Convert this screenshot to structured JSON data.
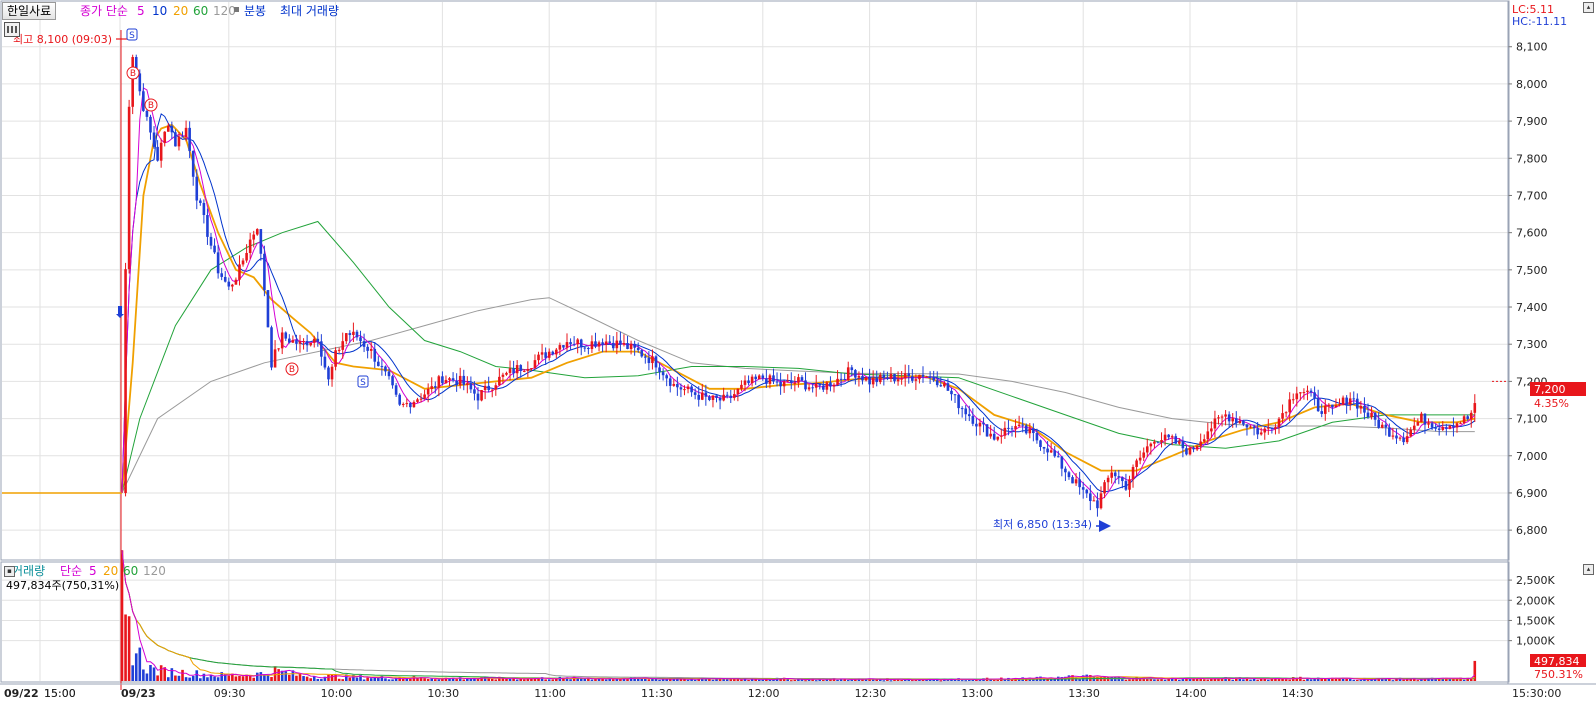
{
  "header": {
    "stock_button": "한일사료",
    "ma_prefix": "종가 단순",
    "ma_periods": [
      "5",
      "10",
      "20",
      "60",
      "120"
    ],
    "toggle_label": "분봉",
    "max_volume_label": "최대 거래량",
    "lc_label": "LC:5.11",
    "hc_label": "HC:-11.11"
  },
  "volume_header": {
    "title": "거래량",
    "ma_prefix": "단순",
    "ma_periods": [
      "5",
      "20",
      "60",
      "120"
    ],
    "current_value": "497,834주(750,31%)"
  },
  "annotations": {
    "high_label": "최고 8,100 (09:03)",
    "low_label": "최저 6,850 (13:34)",
    "signals": [
      "S",
      "B",
      "B",
      "B",
      "S"
    ]
  },
  "price_tag": {
    "value": "7,200",
    "change": "4.35%"
  },
  "volume_tag": {
    "value": "497,834",
    "ratio": "750.31%"
  },
  "colors": {
    "up": "#e8161b",
    "down": "#1f3fd6",
    "ma5": "#d400d4",
    "ma10": "#0033cc",
    "ma20": "#f0a000",
    "ma60": "#22a33a",
    "ma120": "#9a9a9a",
    "grid": "#e2e2e2"
  },
  "chart_data": {
    "type": "candlestick-intraday",
    "x_tick_labels": [
      "09/22",
      "15:00",
      "09/23",
      "09:30",
      "10:00",
      "10:30",
      "11:00",
      "11:30",
      "12:00",
      "12:30",
      "13:00",
      "13:30",
      "14:00",
      "14:30",
      "15:00",
      "15:30:00"
    ],
    "price_axis": {
      "ticks": [
        "6,800",
        "6,900",
        "7,000",
        "7,100",
        "7,200",
        "7,300",
        "7,400",
        "7,500",
        "7,600",
        "7,700",
        "7,800",
        "7,900",
        "8,000",
        "8,100"
      ],
      "range": [
        6760,
        8145
      ]
    },
    "volume_axis": {
      "ticks": [
        "1,000K",
        "1,500K",
        "2,000K",
        "2,500K"
      ],
      "range": [
        0,
        2750000
      ]
    },
    "prev_close": 6900,
    "high": {
      "price": 8100,
      "time": "09:03"
    },
    "low": {
      "price": 6850,
      "time": "13:34"
    },
    "last_price": 7200,
    "last_change_pct": 4.35,
    "last_volume": 497834,
    "last_volume_ratio_pct": 750.31,
    "price_path": [
      [
        "09:00",
        6900
      ],
      [
        "09:01",
        7500
      ],
      [
        "09:02",
        7950
      ],
      [
        "09:03",
        8080
      ],
      [
        "09:05",
        7980
      ],
      [
        "09:07",
        7900
      ],
      [
        "09:10",
        7800
      ],
      [
        "09:13",
        7900
      ],
      [
        "09:15",
        7840
      ],
      [
        "09:18",
        7880
      ],
      [
        "09:21",
        7700
      ],
      [
        "09:24",
        7600
      ],
      [
        "09:27",
        7500
      ],
      [
        "09:30",
        7450
      ],
      [
        "09:33",
        7500
      ],
      [
        "09:36",
        7580
      ],
      [
        "09:38",
        7620
      ],
      [
        "09:40",
        7450
      ],
      [
        "09:42",
        7250
      ],
      [
        "09:45",
        7320
      ],
      [
        "09:50",
        7300
      ],
      [
        "09:55",
        7320
      ],
      [
        "09:58",
        7200
      ],
      [
        "10:00",
        7270
      ],
      [
        "10:03",
        7330
      ],
      [
        "10:06",
        7320
      ],
      [
        "10:10",
        7280
      ],
      [
        "10:15",
        7200
      ],
      [
        "10:18",
        7130
      ],
      [
        "10:22",
        7150
      ],
      [
        "10:27",
        7180
      ],
      [
        "10:30",
        7210
      ],
      [
        "10:35",
        7200
      ],
      [
        "10:40",
        7160
      ],
      [
        "10:45",
        7200
      ],
      [
        "10:50",
        7230
      ],
      [
        "10:55",
        7250
      ],
      [
        "11:00",
        7280
      ],
      [
        "11:05",
        7310
      ],
      [
        "11:10",
        7300
      ],
      [
        "11:15",
        7310
      ],
      [
        "11:20",
        7300
      ],
      [
        "11:25",
        7280
      ],
      [
        "11:30",
        7250
      ],
      [
        "11:35",
        7190
      ],
      [
        "11:40",
        7170
      ],
      [
        "11:45",
        7150
      ],
      [
        "11:50",
        7150
      ],
      [
        "11:55",
        7190
      ],
      [
        "12:00",
        7210
      ],
      [
        "12:05",
        7190
      ],
      [
        "12:10",
        7200
      ],
      [
        "12:15",
        7180
      ],
      [
        "12:20",
        7200
      ],
      [
        "12:25",
        7230
      ],
      [
        "12:30",
        7200
      ],
      [
        "12:35",
        7210
      ],
      [
        "12:40",
        7210
      ],
      [
        "12:45",
        7220
      ],
      [
        "12:50",
        7200
      ],
      [
        "12:55",
        7140
      ],
      [
        "13:00",
        7090
      ],
      [
        "13:05",
        7050
      ],
      [
        "13:10",
        7080
      ],
      [
        "13:15",
        7060
      ],
      [
        "13:20",
        7020
      ],
      [
        "13:25",
        6960
      ],
      [
        "13:30",
        6900
      ],
      [
        "13:34",
        6870
      ],
      [
        "13:38",
        6960
      ],
      [
        "13:42",
        6920
      ],
      [
        "13:45",
        6980
      ],
      [
        "13:50",
        7050
      ],
      [
        "13:55",
        7040
      ],
      [
        "14:00",
        7010
      ],
      [
        "14:05",
        7070
      ],
      [
        "14:10",
        7110
      ],
      [
        "14:15",
        7090
      ],
      [
        "14:20",
        7060
      ],
      [
        "14:25",
        7100
      ],
      [
        "14:30",
        7180
      ],
      [
        "14:33",
        7170
      ],
      [
        "14:36",
        7130
      ],
      [
        "14:40",
        7120
      ],
      [
        "14:45",
        7160
      ],
      [
        "14:50",
        7110
      ],
      [
        "14:55",
        7070
      ],
      [
        "15:00",
        7050
      ],
      [
        "15:05",
        7100
      ],
      [
        "15:10",
        7080
      ],
      [
        "15:15",
        7090
      ],
      [
        "15:18",
        7100
      ],
      [
        "15:20",
        7130
      ]
    ],
    "moving_averages_price": {
      "ma20": [
        [
          "09:00",
          6900
        ],
        [
          "09:03",
          7250
        ],
        [
          "09:06",
          7700
        ],
        [
          "09:09",
          7850
        ],
        [
          "09:11",
          7880
        ],
        [
          "09:14",
          7890
        ],
        [
          "09:18",
          7850
        ],
        [
          "09:22",
          7730
        ],
        [
          "09:27",
          7600
        ],
        [
          "09:32",
          7500
        ],
        [
          "09:37",
          7480
        ],
        [
          "09:42",
          7420
        ],
        [
          "09:48",
          7370
        ],
        [
          "09:53",
          7330
        ],
        [
          "10:00",
          7250
        ],
        [
          "10:05",
          7240
        ],
        [
          "10:15",
          7230
        ],
        [
          "10:25",
          7180
        ],
        [
          "10:35",
          7190
        ],
        [
          "10:45",
          7200
        ],
        [
          "10:55",
          7210
        ],
        [
          "11:05",
          7250
        ],
        [
          "11:15",
          7280
        ],
        [
          "11:25",
          7280
        ],
        [
          "11:35",
          7230
        ],
        [
          "11:45",
          7180
        ],
        [
          "11:55",
          7180
        ],
        [
          "12:05",
          7190
        ],
        [
          "12:15",
          7195
        ],
        [
          "12:25",
          7205
        ],
        [
          "12:35",
          7210
        ],
        [
          "12:45",
          7215
        ],
        [
          "12:55",
          7180
        ],
        [
          "13:05",
          7110
        ],
        [
          "13:15",
          7080
        ],
        [
          "13:25",
          7010
        ],
        [
          "13:35",
          6960
        ],
        [
          "13:45",
          6960
        ],
        [
          "13:55",
          7000
        ],
        [
          "14:05",
          7040
        ],
        [
          "14:15",
          7070
        ],
        [
          "14:25",
          7090
        ],
        [
          "14:35",
          7130
        ],
        [
          "14:45",
          7140
        ],
        [
          "14:55",
          7110
        ],
        [
          "15:05",
          7090
        ],
        [
          "15:15",
          7090
        ],
        [
          "15:20",
          7100
        ]
      ],
      "ma60": [
        [
          "09:00",
          6900
        ],
        [
          "09:05",
          7100
        ],
        [
          "09:15",
          7350
        ],
        [
          "09:25",
          7500
        ],
        [
          "09:35",
          7560
        ],
        [
          "09:45",
          7600
        ],
        [
          "09:55",
          7630
        ],
        [
          "10:05",
          7520
        ],
        [
          "10:15",
          7400
        ],
        [
          "10:25",
          7310
        ],
        [
          "10:35",
          7280
        ],
        [
          "10:45",
          7240
        ],
        [
          "10:55",
          7230
        ],
        [
          "11:10",
          7210
        ],
        [
          "11:25",
          7215
        ],
        [
          "11:40",
          7240
        ],
        [
          "11:55",
          7240
        ],
        [
          "12:10",
          7235
        ],
        [
          "12:25",
          7220
        ],
        [
          "12:40",
          7215
        ],
        [
          "12:55",
          7210
        ],
        [
          "13:10",
          7160
        ],
        [
          "13:25",
          7110
        ],
        [
          "13:40",
          7060
        ],
        [
          "13:55",
          7030
        ],
        [
          "14:10",
          7020
        ],
        [
          "14:25",
          7040
        ],
        [
          "14:40",
          7090
        ],
        [
          "14:55",
          7110
        ],
        [
          "15:10",
          7110
        ],
        [
          "15:20",
          7110
        ]
      ],
      "ma120": [
        [
          "09:00",
          6900
        ],
        [
          "09:10",
          7100
        ],
        [
          "09:25",
          7200
        ],
        [
          "09:40",
          7250
        ],
        [
          "09:55",
          7280
        ],
        [
          "10:10",
          7310
        ],
        [
          "10:25",
          7350
        ],
        [
          "10:40",
          7390
        ],
        [
          "10:55",
          7420
        ],
        [
          "11:00",
          7425
        ],
        [
          "11:10",
          7380
        ],
        [
          "11:25",
          7310
        ],
        [
          "11:40",
          7250
        ],
        [
          "11:55",
          7235
        ],
        [
          "12:10",
          7228
        ],
        [
          "12:25",
          7222
        ],
        [
          "12:40",
          7221
        ],
        [
          "12:55",
          7220
        ],
        [
          "13:10",
          7200
        ],
        [
          "13:25",
          7170
        ],
        [
          "13:40",
          7130
        ],
        [
          "13:55",
          7100
        ],
        [
          "14:10",
          7085
        ],
        [
          "14:25",
          7080
        ],
        [
          "14:40",
          7080
        ],
        [
          "14:55",
          7075
        ],
        [
          "15:10",
          7065
        ],
        [
          "15:20",
          7065
        ]
      ]
    },
    "volume_samples": [
      [
        "09:00",
        2500000
      ],
      [
        "09:01",
        1100000
      ],
      [
        "09:02",
        1300000
      ],
      [
        "09:03",
        900000
      ],
      [
        "09:04",
        700000
      ],
      [
        "09:05",
        600000
      ],
      [
        "09:06",
        450000
      ],
      [
        "09:07",
        380000
      ],
      [
        "09:08",
        300000
      ],
      [
        "09:10",
        260000
      ],
      [
        "09:12",
        240000
      ],
      [
        "09:15",
        220000
      ],
      [
        "09:18",
        200000
      ],
      [
        "09:22",
        170000
      ],
      [
        "09:26",
        150000
      ],
      [
        "09:30",
        140000
      ],
      [
        "09:35",
        160000
      ],
      [
        "09:40",
        180000
      ],
      [
        "09:43",
        260000
      ],
      [
        "09:46",
        200000
      ],
      [
        "09:50",
        140000
      ],
      [
        "09:55",
        120000
      ],
      [
        "10:00",
        110000
      ],
      [
        "10:05",
        100000
      ],
      [
        "10:10",
        90000
      ],
      [
        "10:20",
        80000
      ],
      [
        "10:30",
        70000
      ],
      [
        "10:45",
        65000
      ],
      [
        "11:00",
        70000
      ],
      [
        "11:15",
        65000
      ],
      [
        "11:30",
        55000
      ],
      [
        "11:45",
        50000
      ],
      [
        "12:00",
        55000
      ],
      [
        "12:15",
        45000
      ],
      [
        "12:30",
        45000
      ],
      [
        "12:45",
        40000
      ],
      [
        "13:00",
        50000
      ],
      [
        "13:15",
        60000
      ],
      [
        "13:30",
        110000
      ],
      [
        "13:35",
        90000
      ],
      [
        "13:45",
        70000
      ],
      [
        "14:00",
        60000
      ],
      [
        "14:15",
        60000
      ],
      [
        "14:30",
        70000
      ],
      [
        "14:45",
        55000
      ],
      [
        "15:00",
        50000
      ],
      [
        "15:15",
        55000
      ],
      [
        "15:20",
        497834
      ]
    ]
  }
}
